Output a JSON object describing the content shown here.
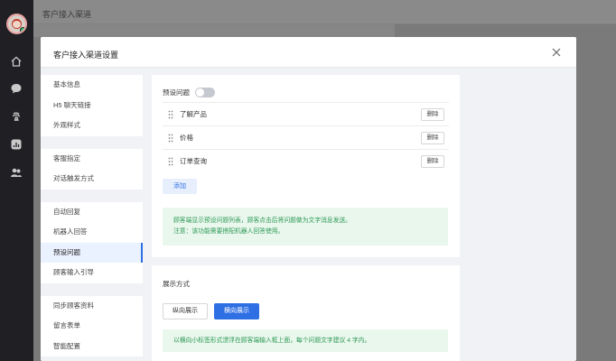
{
  "topbar": {
    "title": "客户接入渠道"
  },
  "rail": {
    "icons": [
      "home-icon",
      "chat-icon",
      "fingerprint-icon",
      "stats-icon",
      "team-icon"
    ]
  },
  "modal": {
    "title": "客户接入渠道设置",
    "close_icon": "close-icon"
  },
  "sidebar": {
    "groups": [
      {
        "items": [
          {
            "label": "基本信息"
          },
          {
            "label": "H5 聊天链接"
          },
          {
            "label": "外观样式"
          }
        ]
      },
      {
        "items": [
          {
            "label": "客服指定"
          },
          {
            "label": "对话触发方式"
          }
        ]
      },
      {
        "items": [
          {
            "label": "自动回复"
          },
          {
            "label": "机器人回答"
          },
          {
            "label": "预设问题",
            "active": true
          },
          {
            "label": "顾客输入引导"
          }
        ]
      },
      {
        "items": [
          {
            "label": "同步顾客资料"
          },
          {
            "label": "留言表单"
          },
          {
            "label": "智能配置"
          }
        ]
      }
    ]
  },
  "preset": {
    "label": "预设问题",
    "toggle_on": false,
    "questions": [
      {
        "text": "了解产品",
        "delete_label": "删除"
      },
      {
        "text": "价格",
        "delete_label": "删除"
      },
      {
        "text": "订单查询",
        "delete_label": "删除"
      }
    ],
    "add_label": "添加",
    "tip_line1": "顾客端显示预设问题列表，顾客点击后将问题做为文字消息发送。",
    "tip_line2": "注意：该功能需要搭配机器人回答使用。"
  },
  "display": {
    "title": "展示方式",
    "options": [
      {
        "label": "纵向展示",
        "selected": false
      },
      {
        "label": "横向展示",
        "selected": true
      }
    ],
    "tip": "以横向小标签形式漂浮在顾客端输入框上面，每个问题文字建议 4 字内。"
  },
  "colors": {
    "accent": "#2f6fe4",
    "tip_bg": "#e9f7ed",
    "tip_text": "#2f9a56"
  }
}
